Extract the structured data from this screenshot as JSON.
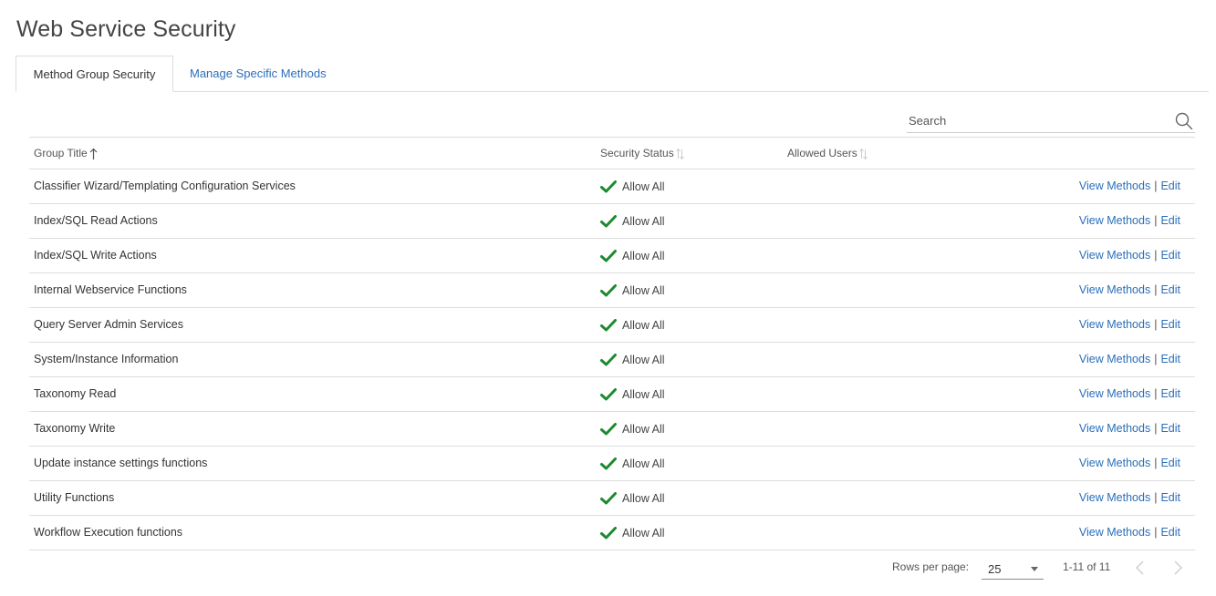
{
  "page": {
    "title": "Web Service Security"
  },
  "tabs": [
    {
      "label": "Method Group Security",
      "active": true
    },
    {
      "label": "Manage Specific Methods",
      "active": false
    }
  ],
  "search": {
    "placeholder": "Search",
    "value": ""
  },
  "table": {
    "columns": {
      "group_title": "Group Title",
      "security_status": "Security Status",
      "allowed_users": "Allowed Users"
    },
    "rows": [
      {
        "title": "Classifier Wizard/Templating Configuration Services",
        "status": "Allow All",
        "allowed_users": "",
        "view": "View Methods",
        "edit": "Edit"
      },
      {
        "title": "Index/SQL Read Actions",
        "status": "Allow All",
        "allowed_users": "",
        "view": "View Methods",
        "edit": "Edit"
      },
      {
        "title": "Index/SQL Write Actions",
        "status": "Allow All",
        "allowed_users": "",
        "view": "View Methods",
        "edit": "Edit"
      },
      {
        "title": "Internal Webservice Functions",
        "status": "Allow All",
        "allowed_users": "",
        "view": "View Methods",
        "edit": "Edit"
      },
      {
        "title": "Query Server Admin Services",
        "status": "Allow All",
        "allowed_users": "",
        "view": "View Methods",
        "edit": "Edit"
      },
      {
        "title": "System/Instance Information",
        "status": "Allow All",
        "allowed_users": "",
        "view": "View Methods",
        "edit": "Edit"
      },
      {
        "title": "Taxonomy Read",
        "status": "Allow All",
        "allowed_users": "",
        "view": "View Methods",
        "edit": "Edit"
      },
      {
        "title": "Taxonomy Write",
        "status": "Allow All",
        "allowed_users": "",
        "view": "View Methods",
        "edit": "Edit"
      },
      {
        "title": "Update instance settings functions",
        "status": "Allow All",
        "allowed_users": "",
        "view": "View Methods",
        "edit": "Edit"
      },
      {
        "title": "Utility Functions",
        "status": "Allow All",
        "allowed_users": "",
        "view": "View Methods",
        "edit": "Edit"
      },
      {
        "title": "Workflow Execution functions",
        "status": "Allow All",
        "allowed_users": "",
        "view": "View Methods",
        "edit": "Edit"
      }
    ],
    "separator": "|"
  },
  "pagination": {
    "rows_per_page_label": "Rows per page:",
    "rows_per_page_value": "25",
    "range": "1-11 of 11"
  },
  "colors": {
    "link": "#2a6ebb",
    "check": "#1e8a2e",
    "border": "#dddddd"
  },
  "icons": {
    "search": "search-icon",
    "check": "checkmark-icon",
    "sort_asc": "arrow-up-icon",
    "sort": "sort-icon",
    "prev": "chevron-left-icon",
    "next": "chevron-right-icon",
    "dropdown": "caret-down-icon"
  }
}
